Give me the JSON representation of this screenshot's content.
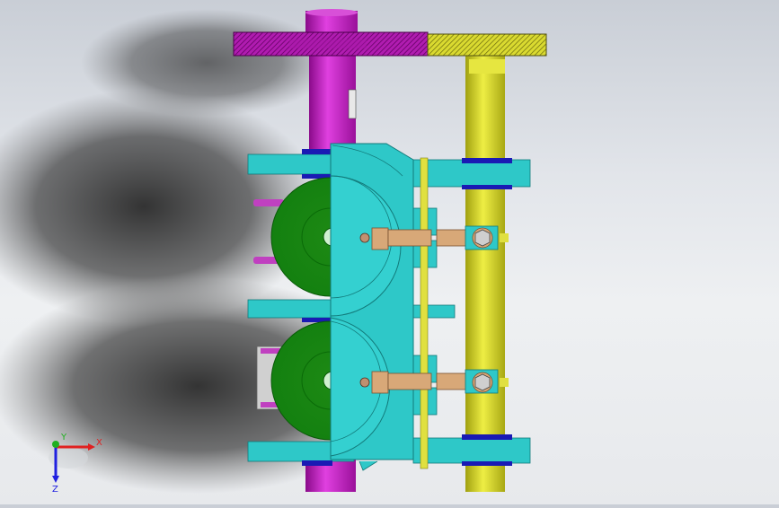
{
  "viewport": {
    "background_top": "#c9ced6",
    "background_bottom": "#eef0f2",
    "shadow_color": "#2a2a2a"
  },
  "colors": {
    "magenta_shaft": "#c81ec8",
    "yellow_shaft": "#d2d21e",
    "cyan_body": "#2ec8c8",
    "green_disc": "#1e9614",
    "blue_bearing": "#1a1ab4",
    "tan_link": "#d8a878",
    "axis_x": "#e02020",
    "axis_y": "#20b020",
    "axis_z": "#2020e0"
  },
  "triad": {
    "x_label": "X",
    "y_label": "Y",
    "z_label": "Z"
  }
}
